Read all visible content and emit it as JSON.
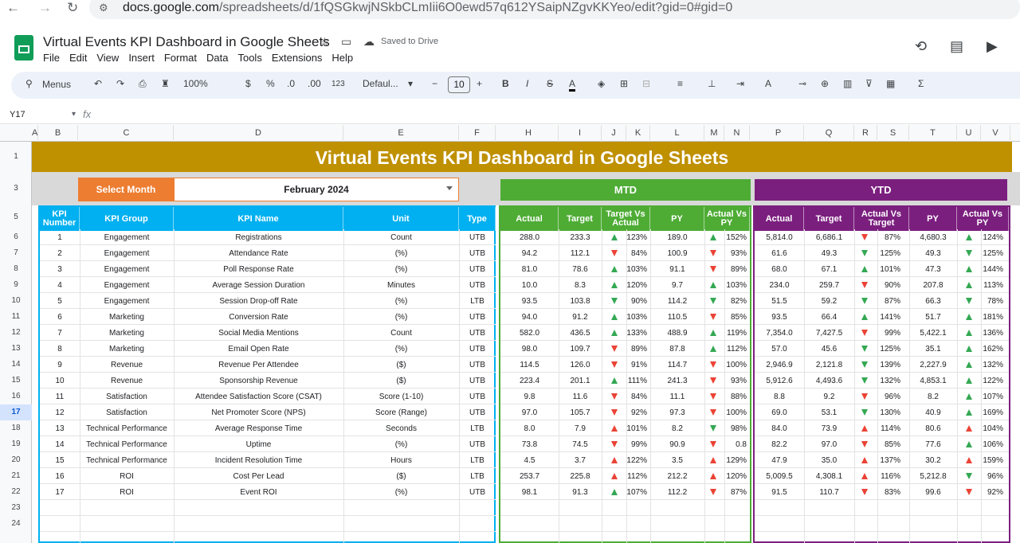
{
  "browser": {
    "url_domain": "docs.google.com",
    "url_path": "/spreadsheets/d/1fQSGkwjNSkbCLmIii6O0ewd57q612YSaipNZgvKKYeo/edit?gid=0#gid=0"
  },
  "doc": {
    "title": "Virtual Events KPI Dashboard in Google Sheets",
    "saved_status": "Saved to Drive",
    "menus": [
      "File",
      "Edit",
      "View",
      "Insert",
      "Format",
      "Data",
      "Tools",
      "Extensions",
      "Help"
    ]
  },
  "toolbar": {
    "menus_label": "Menus",
    "zoom": "100%",
    "currency": "$",
    "percent": "%",
    "dec_dec": ".0",
    "inc_dec": ".00",
    "number_format": "123",
    "font": "Defaul...",
    "font_size": "10"
  },
  "formula_bar": {
    "name_box": "Y17",
    "fx": "fx"
  },
  "columns": [
    "A",
    "B",
    "C",
    "D",
    "E",
    "F",
    "H",
    "I",
    "J",
    "K",
    "L",
    "M",
    "N",
    "P",
    "Q",
    "R",
    "S",
    "T",
    "U",
    "V"
  ],
  "rows": [
    "1",
    "3",
    "5",
    "6",
    "7",
    "8",
    "9",
    "10",
    "11",
    "12",
    "13",
    "14",
    "15",
    "16",
    "17",
    "18",
    "19",
    "20",
    "21",
    "22",
    "23",
    "24"
  ],
  "selected_row": "17",
  "dashboard": {
    "banner": "Virtual Events KPI Dashboard in Google Sheets",
    "select_month_label": "Select Month",
    "selected_month": "February 2024",
    "mtd_label": "MTD",
    "ytd_label": "YTD",
    "headers_left": [
      "KPI Number",
      "KPI Group",
      "KPI Name",
      "Unit",
      "Type"
    ],
    "headers_mtd": [
      "Actual",
      "Target",
      "Target Vs Actual",
      "PY",
      "Actual Vs PY"
    ],
    "headers_ytd": [
      "Actual",
      "Target",
      "Actual Vs Target",
      "PY",
      "Actual Vs PY"
    ],
    "colors": {
      "banner": "#bf9000",
      "month_label": "#ed7d31",
      "mtd": "#4eac35",
      "ytd": "#7b1f7f",
      "left_header": "#00b0f0"
    }
  },
  "kpis": [
    {
      "num": "1",
      "group": "Engagement",
      "name": "Registrations",
      "unit": "Count",
      "type": "UTB",
      "m_act": "288.0",
      "m_tgt": "233.3",
      "m_tva": "123%",
      "m_tva_dir": "up-green",
      "m_py": "189.0",
      "m_avp": "152%",
      "m_avp_dir": "up-green",
      "y_act": "5,814.0",
      "y_tgt": "6,686.1",
      "y_avt": "87%",
      "y_avt_dir": "down-red",
      "y_py": "4,680.3",
      "y_avp": "124%",
      "y_avp_dir": "up-green"
    },
    {
      "num": "2",
      "group": "Engagement",
      "name": "Attendance Rate",
      "unit": "(%)",
      "type": "UTB",
      "m_act": "94.2",
      "m_tgt": "112.1",
      "m_tva": "84%",
      "m_tva_dir": "down-red",
      "m_py": "100.9",
      "m_avp": "93%",
      "m_avp_dir": "down-red",
      "y_act": "61.6",
      "y_tgt": "49.3",
      "y_avt": "125%",
      "y_avt_dir": "down-green",
      "y_py": "49.3",
      "y_avp": "125%",
      "y_avp_dir": "down-green"
    },
    {
      "num": "3",
      "group": "Engagement",
      "name": "Poll Response Rate",
      "unit": "(%)",
      "type": "UTB",
      "m_act": "81.0",
      "m_tgt": "78.6",
      "m_tva": "103%",
      "m_tva_dir": "up-green",
      "m_py": "91.1",
      "m_avp": "89%",
      "m_avp_dir": "down-red",
      "y_act": "68.0",
      "y_tgt": "67.1",
      "y_avt": "101%",
      "y_avt_dir": "up-green",
      "y_py": "47.3",
      "y_avp": "144%",
      "y_avp_dir": "up-green"
    },
    {
      "num": "4",
      "group": "Engagement",
      "name": "Average Session Duration",
      "unit": "Minutes",
      "type": "UTB",
      "m_act": "10.0",
      "m_tgt": "8.3",
      "m_tva": "120%",
      "m_tva_dir": "up-green",
      "m_py": "9.7",
      "m_avp": "103%",
      "m_avp_dir": "up-green",
      "y_act": "234.0",
      "y_tgt": "259.7",
      "y_avt": "90%",
      "y_avt_dir": "down-red",
      "y_py": "207.8",
      "y_avp": "113%",
      "y_avp_dir": "up-green"
    },
    {
      "num": "5",
      "group": "Engagement",
      "name": "Session Drop-off Rate",
      "unit": "(%)",
      "type": "LTB",
      "m_act": "93.5",
      "m_tgt": "103.8",
      "m_tva": "90%",
      "m_tva_dir": "down-green",
      "m_py": "114.2",
      "m_avp": "82%",
      "m_avp_dir": "down-green",
      "y_act": "51.5",
      "y_tgt": "59.2",
      "y_avt": "87%",
      "y_avt_dir": "down-green",
      "y_py": "66.3",
      "y_avp": "78%",
      "y_avp_dir": "down-green"
    },
    {
      "num": "6",
      "group": "Marketing",
      "name": "Conversion Rate",
      "unit": "(%)",
      "type": "UTB",
      "m_act": "94.0",
      "m_tgt": "91.2",
      "m_tva": "103%",
      "m_tva_dir": "up-green",
      "m_py": "110.5",
      "m_avp": "85%",
      "m_avp_dir": "down-red",
      "y_act": "93.5",
      "y_tgt": "66.4",
      "y_avt": "141%",
      "y_avt_dir": "up-green",
      "y_py": "51.7",
      "y_avp": "181%",
      "y_avp_dir": "up-green"
    },
    {
      "num": "7",
      "group": "Marketing",
      "name": "Social Media Mentions",
      "unit": "Count",
      "type": "UTB",
      "m_act": "582.0",
      "m_tgt": "436.5",
      "m_tva": "133%",
      "m_tva_dir": "up-green",
      "m_py": "488.9",
      "m_avp": "119%",
      "m_avp_dir": "up-green",
      "y_act": "7,354.0",
      "y_tgt": "7,427.5",
      "y_avt": "99%",
      "y_avt_dir": "down-red",
      "y_py": "5,422.1",
      "y_avp": "136%",
      "y_avp_dir": "up-green"
    },
    {
      "num": "8",
      "group": "Marketing",
      "name": "Email Open Rate",
      "unit": "(%)",
      "type": "UTB",
      "m_act": "98.0",
      "m_tgt": "109.7",
      "m_tva": "89%",
      "m_tva_dir": "down-red",
      "m_py": "87.8",
      "m_avp": "112%",
      "m_avp_dir": "up-green",
      "y_act": "57.0",
      "y_tgt": "45.6",
      "y_avt": "125%",
      "y_avt_dir": "down-green",
      "y_py": "35.1",
      "y_avp": "162%",
      "y_avp_dir": "up-green"
    },
    {
      "num": "9",
      "group": "Revenue",
      "name": "Revenue Per Attendee",
      "unit": "($)",
      "type": "UTB",
      "m_act": "114.5",
      "m_tgt": "126.0",
      "m_tva": "91%",
      "m_tva_dir": "down-red",
      "m_py": "114.7",
      "m_avp": "100%",
      "m_avp_dir": "down-red",
      "y_act": "2,946.9",
      "y_tgt": "2,121.8",
      "y_avt": "139%",
      "y_avt_dir": "down-green",
      "y_py": "2,227.9",
      "y_avp": "132%",
      "y_avp_dir": "up-green"
    },
    {
      "num": "10",
      "group": "Revenue",
      "name": "Sponsorship Revenue",
      "unit": "($)",
      "type": "UTB",
      "m_act": "223.4",
      "m_tgt": "201.1",
      "m_tva": "111%",
      "m_tva_dir": "up-green",
      "m_py": "241.3",
      "m_avp": "93%",
      "m_avp_dir": "down-red",
      "y_act": "5,912.6",
      "y_tgt": "4,493.6",
      "y_avt": "132%",
      "y_avt_dir": "down-green",
      "y_py": "4,853.1",
      "y_avp": "122%",
      "y_avp_dir": "up-green"
    },
    {
      "num": "11",
      "group": "Satisfaction",
      "name": "Attendee Satisfaction Score (CSAT)",
      "unit": "Score (1-10)",
      "type": "UTB",
      "m_act": "9.8",
      "m_tgt": "11.6",
      "m_tva": "84%",
      "m_tva_dir": "down-red",
      "m_py": "11.1",
      "m_avp": "88%",
      "m_avp_dir": "down-red",
      "y_act": "8.8",
      "y_tgt": "9.2",
      "y_avt": "96%",
      "y_avt_dir": "down-red",
      "y_py": "8.2",
      "y_avp": "107%",
      "y_avp_dir": "up-green"
    },
    {
      "num": "12",
      "group": "Satisfaction",
      "name": "Net Promoter Score (NPS)",
      "unit": "Score (Range)",
      "type": "UTB",
      "m_act": "97.0",
      "m_tgt": "105.7",
      "m_tva": "92%",
      "m_tva_dir": "down-red",
      "m_py": "97.3",
      "m_avp": "100%",
      "m_avp_dir": "down-red",
      "y_act": "69.0",
      "y_tgt": "53.1",
      "y_avt": "130%",
      "y_avt_dir": "down-green",
      "y_py": "40.9",
      "y_avp": "169%",
      "y_avp_dir": "up-green"
    },
    {
      "num": "13",
      "group": "Technical Performance",
      "name": "Average Response Time",
      "unit": "Seconds",
      "type": "LTB",
      "m_act": "8.0",
      "m_tgt": "7.9",
      "m_tva": "101%",
      "m_tva_dir": "up-red",
      "m_py": "8.2",
      "m_avp": "98%",
      "m_avp_dir": "down-green",
      "y_act": "84.0",
      "y_tgt": "73.9",
      "y_avt": "114%",
      "y_avt_dir": "up-red",
      "y_py": "80.6",
      "y_avp": "104%",
      "y_avp_dir": "up-red"
    },
    {
      "num": "14",
      "group": "Technical Performance",
      "name": "Uptime",
      "unit": "(%)",
      "type": "UTB",
      "m_act": "73.8",
      "m_tgt": "74.5",
      "m_tva": "99%",
      "m_tva_dir": "down-red",
      "m_py": "90.9",
      "m_avp": "0.8",
      "m_avp_dir": "down-red",
      "y_act": "82.2",
      "y_tgt": "97.0",
      "y_avt": "85%",
      "y_avt_dir": "down-red",
      "y_py": "77.6",
      "y_avp": "106%",
      "y_avp_dir": "up-green"
    },
    {
      "num": "15",
      "group": "Technical Performance",
      "name": "Incident Resolution Time",
      "unit": "Hours",
      "type": "LTB",
      "m_act": "4.5",
      "m_tgt": "3.7",
      "m_tva": "122%",
      "m_tva_dir": "up-red",
      "m_py": "3.5",
      "m_avp": "129%",
      "m_avp_dir": "up-red",
      "y_act": "47.9",
      "y_tgt": "35.0",
      "y_avt": "137%",
      "y_avt_dir": "up-red",
      "y_py": "30.2",
      "y_avp": "159%",
      "y_avp_dir": "up-red"
    },
    {
      "num": "16",
      "group": "ROI",
      "name": "Cost Per Lead",
      "unit": "($)",
      "type": "LTB",
      "m_act": "253.7",
      "m_tgt": "225.8",
      "m_tva": "112%",
      "m_tva_dir": "up-red",
      "m_py": "212.2",
      "m_avp": "120%",
      "m_avp_dir": "up-red",
      "y_act": "5,009.5",
      "y_tgt": "4,308.1",
      "y_avt": "116%",
      "y_avt_dir": "up-red",
      "y_py": "5,212.8",
      "y_avp": "96%",
      "y_avp_dir": "down-green"
    },
    {
      "num": "17",
      "group": "ROI",
      "name": "Event ROI",
      "unit": "(%)",
      "type": "UTB",
      "m_act": "98.1",
      "m_tgt": "91.3",
      "m_tva": "107%",
      "m_tva_dir": "up-green",
      "m_py": "112.2",
      "m_avp": "87%",
      "m_avp_dir": "down-red",
      "y_act": "91.5",
      "y_tgt": "110.7",
      "y_avt": "83%",
      "y_avt_dir": "down-red",
      "y_py": "99.6",
      "y_avp": "92%",
      "y_avp_dir": "down-red"
    }
  ]
}
